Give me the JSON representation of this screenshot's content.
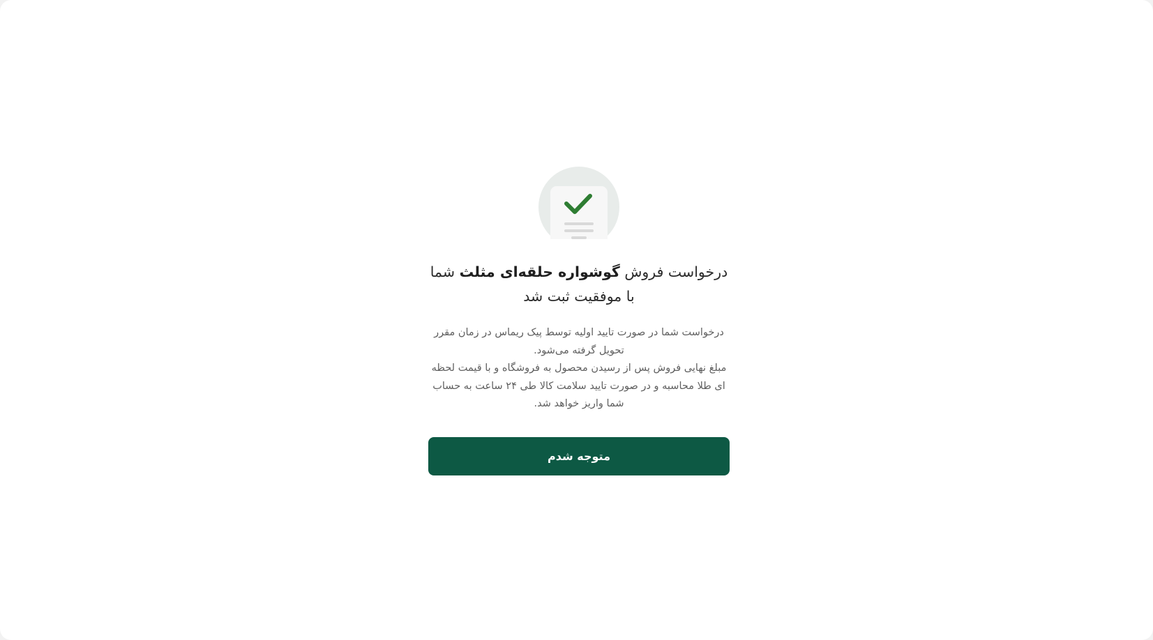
{
  "dialog": {
    "title": {
      "prefix": "درخواست فروش",
      "product_name": "گوشواره حلقه‌ای مثلث",
      "suffix": "شما با موفقیت ثبت شد"
    },
    "description": {
      "line1": "درخواست شما در صورت تایید اولیه توسط پیک ریماس در زمان مقرر تحویل گرفته می‌شود.",
      "line2": "مبلغ نهایی فروش پس از رسیدن محصول به فروشگاه و با قیمت لحظه ای طلا محاسبه و در صورت تایید سلامت کالا طی ۲۴ ساعت به حساب شما واریز خواهد شد."
    },
    "confirm_label": "متوجه شدم",
    "illustration_icon": "document-check-icon"
  },
  "colors": {
    "primary": "#0d5944",
    "check": "#2e7d32",
    "icon_circle": "#e8ecea",
    "text_title": "#2b2b2b",
    "text_body": "#5f5f5f"
  }
}
